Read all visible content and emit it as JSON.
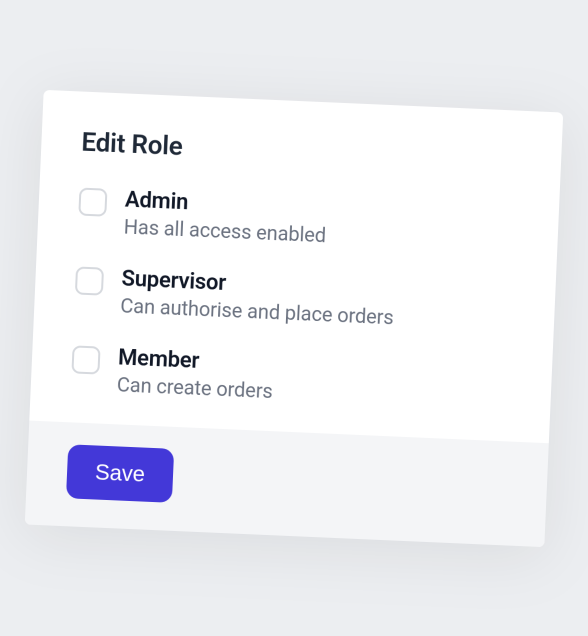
{
  "title": "Edit Role",
  "roles": [
    {
      "label": "Admin",
      "description": "Has all access enabled",
      "checked": false
    },
    {
      "label": "Supervisor",
      "description": "Can authorise and place orders",
      "checked": false
    },
    {
      "label": "Member",
      "description": "Can create orders",
      "checked": false
    }
  ],
  "actions": {
    "save_label": "Save"
  }
}
